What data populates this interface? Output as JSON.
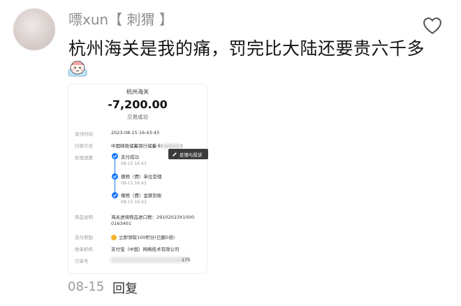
{
  "comment": {
    "username": "嘌xun【 刺猬 】",
    "text": "杭州海关是我的痛，罚完比大陆还要贵六千多",
    "date": "08-15",
    "reply_label": "回复",
    "like_icon": "heart-outline-icon",
    "sticker_icon": "cartoon-sticker-icon"
  },
  "receipt": {
    "merchant": "杭州海关",
    "amount": "-7,200.00",
    "status": "交易成功",
    "rows": {
      "pay_time_label": "支付时间",
      "pay_time": "2023-08-15 16:43:43",
      "pay_method_label": "付款方式",
      "pay_method": "中国邮政储蓄银行储蓄卡(",
      "pay_method_suffix": ")",
      "progress_label": "处理进度",
      "desc_label": "商品说明",
      "desc_line1": "海关进境物品进口税：29102023X1000",
      "desc_line2": "0163401",
      "reward_label": "支付奖励",
      "reward": "立即领取100积分(已翻5倍)",
      "payee_label": "收单机构",
      "payee": "支付宝（中国）网络技术有限公司",
      "order_label": "订单号",
      "order_suffix": "175"
    },
    "steps": [
      {
        "label": "支付成功",
        "time": "08-15 16:43"
      },
      {
        "label": "缴税（费）单位受理",
        "time": "08-15 16:43"
      },
      {
        "label": "缴税（费）金额到账",
        "time": "08-15 16:43"
      }
    ],
    "feedback": "反馈与投诉",
    "accent_color": "#1677ff"
  }
}
